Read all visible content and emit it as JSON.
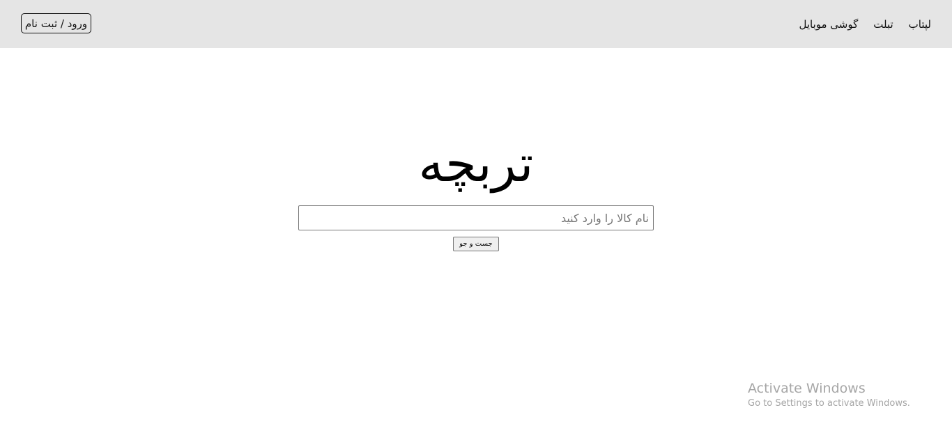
{
  "header": {
    "login_label": "ورود / ثبت نام",
    "nav_items": [
      {
        "label": "گوشی موبایل"
      },
      {
        "label": "تبلت"
      },
      {
        "label": "لپتاب"
      }
    ]
  },
  "main": {
    "logo_text": "تربچه",
    "search": {
      "placeholder": "نام کالا را وارد کنید",
      "value": "",
      "button_label": "جست و جو"
    }
  },
  "watermark": {
    "title": "Activate Windows",
    "subtitle": "Go to Settings to activate Windows."
  }
}
